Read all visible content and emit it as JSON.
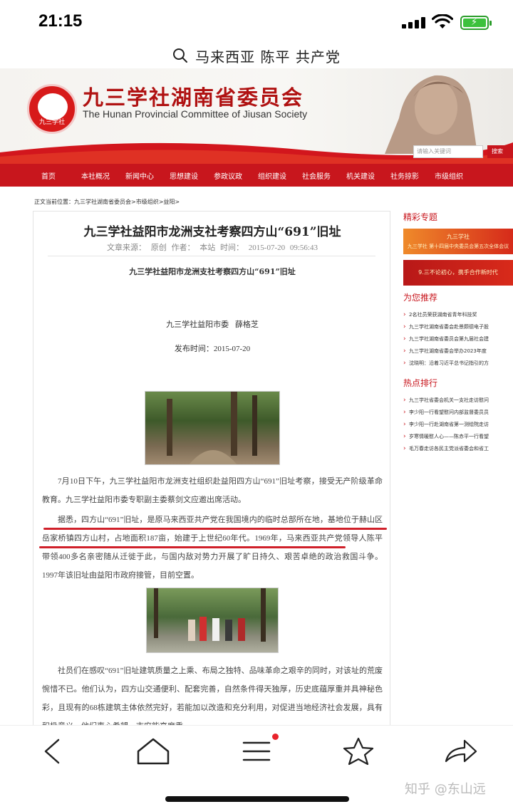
{
  "status": {
    "time": "21:15"
  },
  "search": {
    "query": "马来西亚 陈平 共产党"
  },
  "site": {
    "title": "九三学社湖南省委员会",
    "subtitle": "The Hunan Provincial Committee of Jiusan Society",
    "search_placeholder": "请输入关键词",
    "search_button": "搜索"
  },
  "nav": [
    "首页",
    "本社概况",
    "新闻中心",
    "思想建设",
    "参政议政",
    "组织建设",
    "社会服务",
    "机关建设",
    "社务掠影",
    "市级组织"
  ],
  "breadcrumb": "正文当前位置：九三学社湖南省委员会>市级组织>益阳>",
  "article": {
    "title": "九三学社益阳市龙洲支社考察四方山“691”旧址",
    "meta": "文章来源： 原创 作者： 本站 时间： 2015-07-20 09:56:43",
    "subtitle": "九三学社益阳市龙洲支社考察四方山“691”旧址",
    "author": "九三学社益阳市委 薛格芝",
    "pubtime": "发布时间：2015-07-20",
    "p1": "7月10日下午，九三学社益阳市龙洲支社组织赴益阳四方山“691”旧址考察，接受无产阶级革命教育。九三学社益阳市委专职副主委蔡剑文应邀出席活动。",
    "p2": "据悉，四方山“691”旧址，是原马来西亚共产党在我国境内的临时总部所在地，基地位于赫山区岳家桥镇四方山村，占地面积187亩，始建于上世纪60年代。1969年，马来西亚共产党领导人陈平带领400多名亲密随从迁徙于此，与国内敌对势力开展了旷日持久、艰苦卓绝的政治救国斗争。1997年该旧址由益阳市政府接管，目前空置。",
    "p3": "社员们在感叹“691”旧址建筑质量之上乘、布局之独特、品味革命之艰辛的同时，对该址的荒废惋惜不已。他们认为，四方山交通便利、配套完善，自然条件得天独厚，历史底蕴厚重并具神秘色彩，且现有的68栋建筑主体依然完好，若能加以改造和充分利用，对促进当地经济社会发展，具有积极意义。他们衷心希望，市府能高度重"
  },
  "sidebar": {
    "featured_title": "精彩专题",
    "promo1": "九三学社 第十四届中央委员会第五次全体会议",
    "promo2": "9.三不论初心，携手合作新时代",
    "recommend_title": "为您推荐",
    "recommend": [
      "2名社员荣获湖南省青年科技奖",
      "九三学社湖南省委会赴景颇德电子股",
      "九三学社湖南省委员会第九届社会建",
      "九三学社湖南省委会举办2023年度",
      "沈晓明：沿着习近平总书记指引的方"
    ],
    "hot_title": "热点排行",
    "hot": [
      "九三学社省委会机关一支社走访慰问",
      "李少阳一行看望慰问内部监督委员员",
      "李少阳一行赴湖南省第一测绘院走访",
      "岁寒情暖慰人心——陈赤平一行看望",
      "毛万春走访各民主党派省委会和省工"
    ]
  },
  "watermark": "知乎 @东山远",
  "colors": {
    "brand_red": "#c8161d",
    "underline": "#d0202a"
  }
}
